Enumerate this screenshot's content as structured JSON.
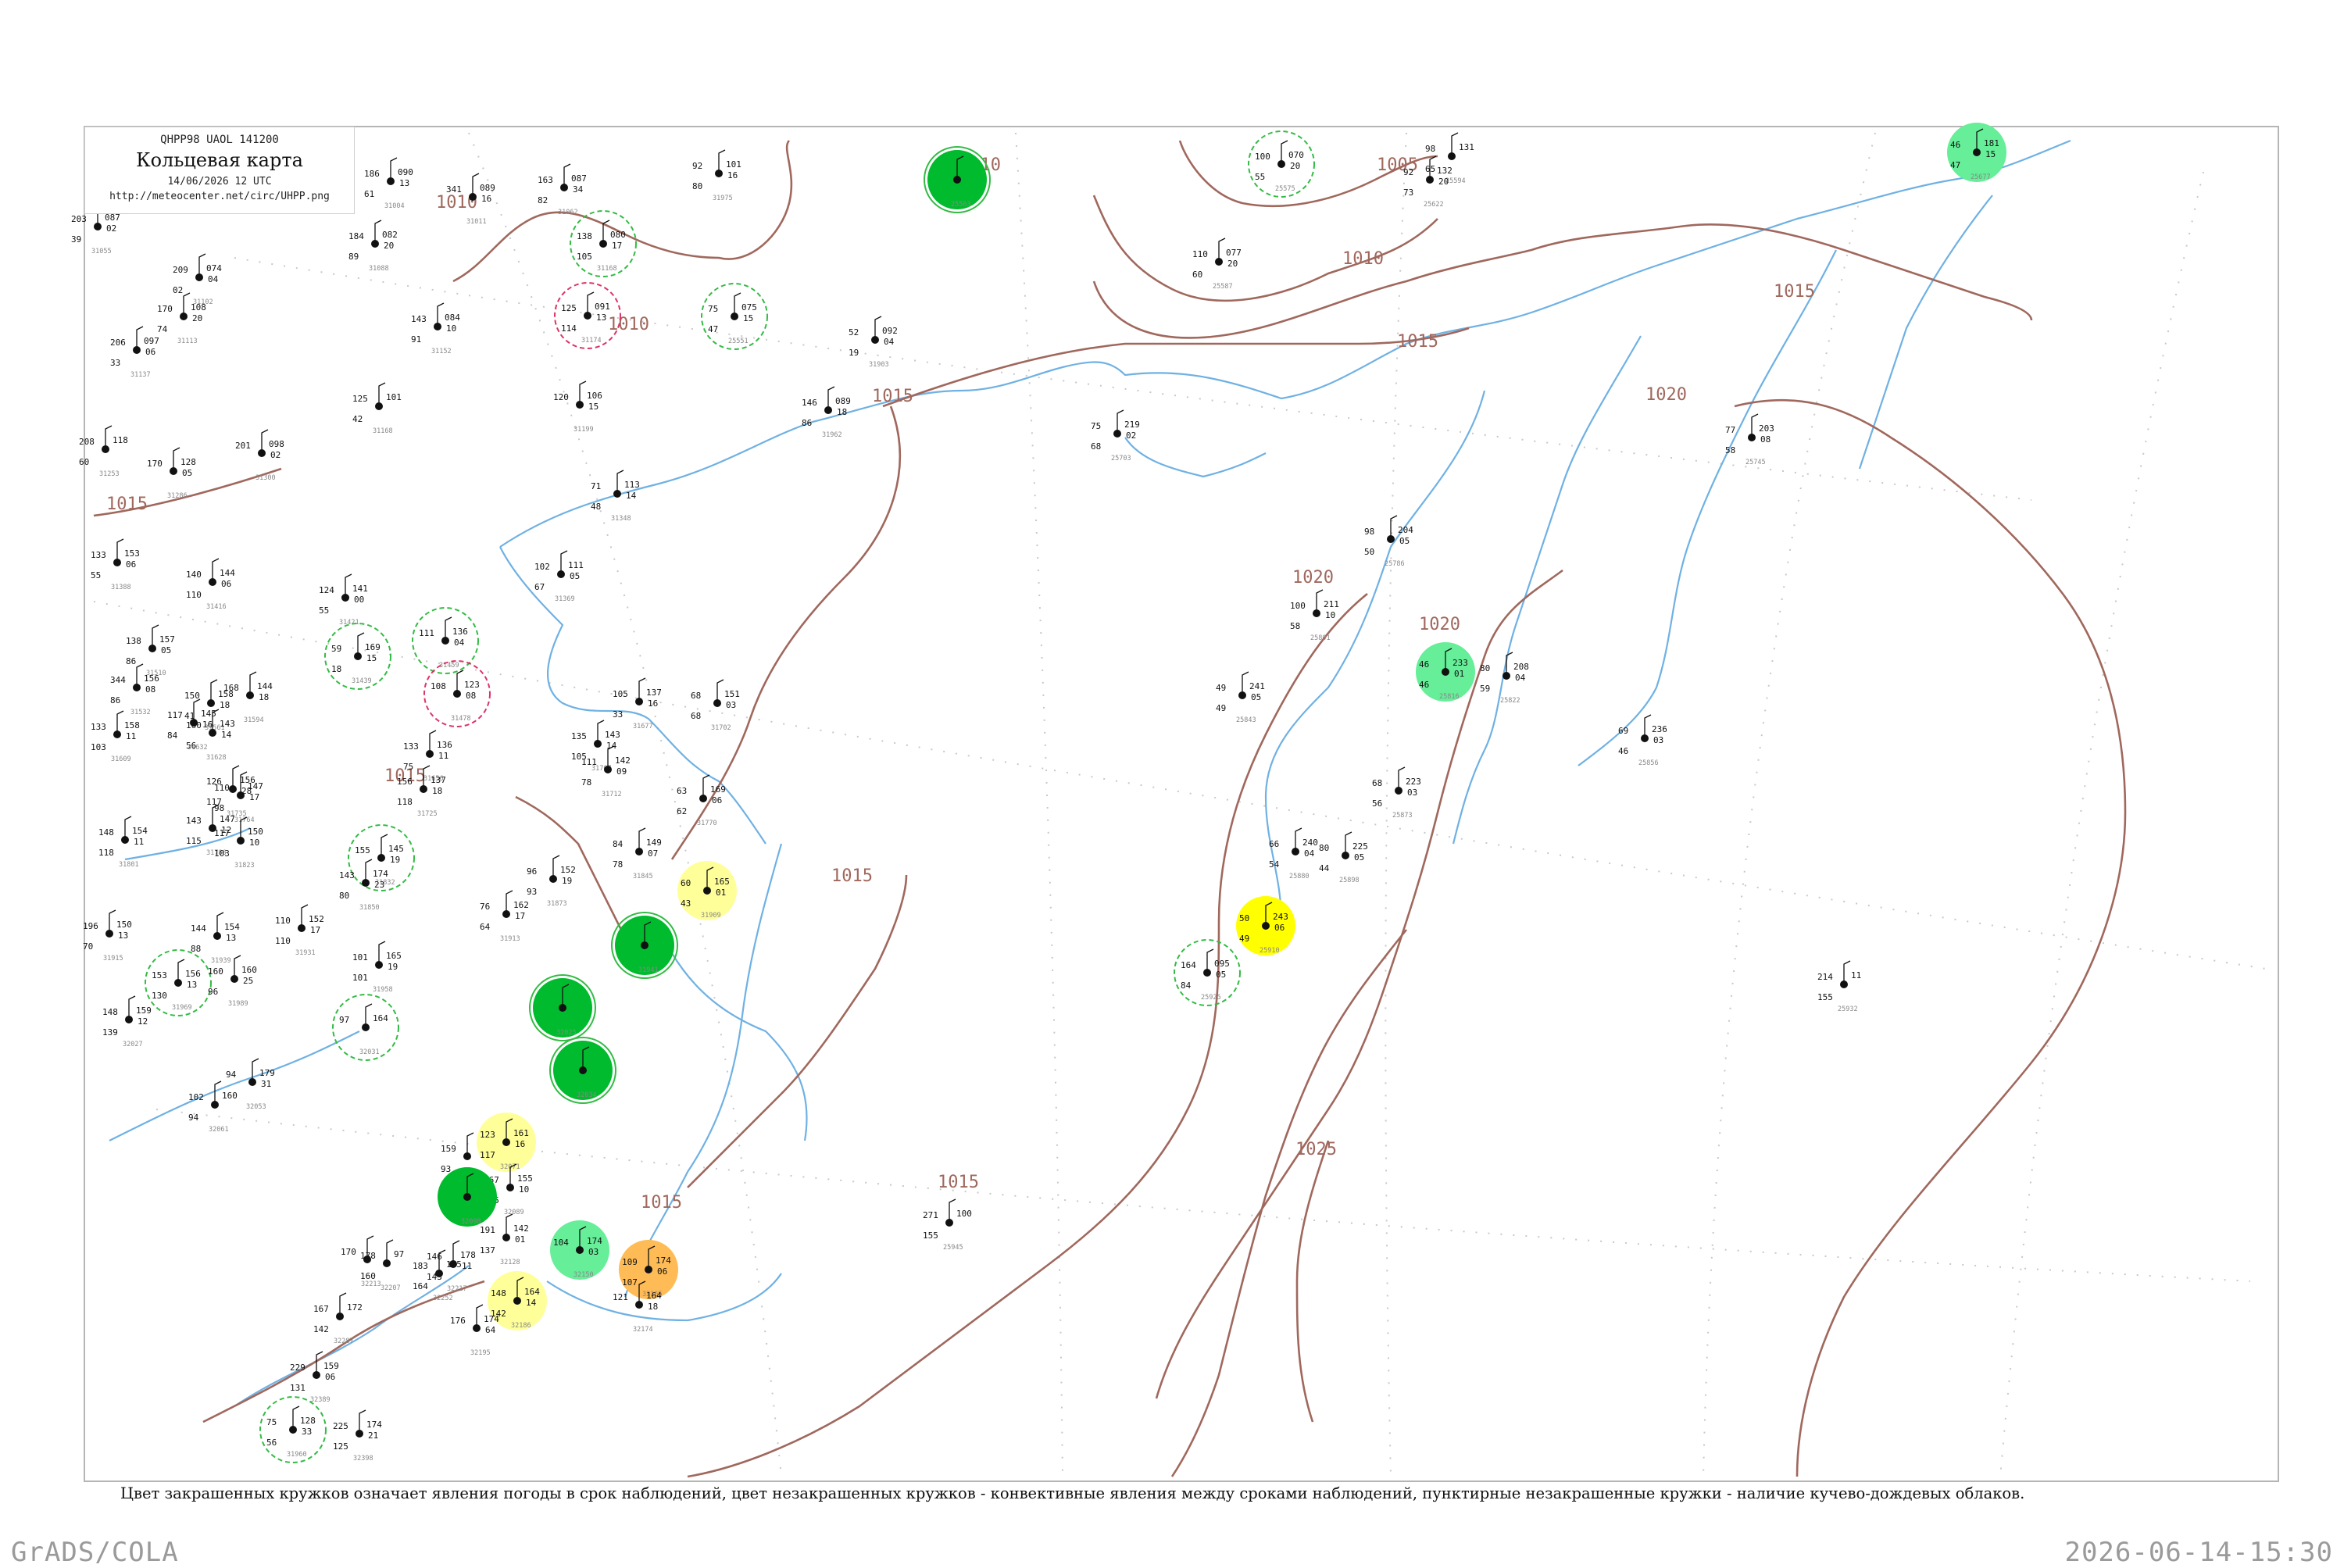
{
  "header": {
    "code": "QHPP98  UAOL  141200",
    "title": "Кольцевая карта",
    "datetime": "14/06/2026 12 UTC",
    "url": "http://meteocenter.net/circ/UHPP.png"
  },
  "footer": {
    "legend": "Цвет закрашенных кружков означает явления погоды в срок наблюдений, цвет незакрашенных кружков - конвективные явления между сроками наблюдений, пунктирные незакрашенные кружки - наличие кучево-дождевых облаков.",
    "credit": "GrADS/COLA",
    "timestamp": "2026-06-14-15:30"
  },
  "colors": {
    "isobar": "#a0685d",
    "coast": "#6fb1e3",
    "green_dark": "#00bb2d",
    "green_light": "#66ee99",
    "yellow": "#ffff00",
    "yellow_light": "#ffff99",
    "orange": "#ffbb55",
    "ring_green": "#33bb44",
    "ring_red": "#dd3366"
  },
  "isobar_labels": [
    "1010",
    "1010",
    "1005",
    "1010",
    "1015",
    "1010",
    "1015",
    "1015",
    "1015",
    "1020",
    "1020",
    "1020",
    "1015",
    "1015",
    "1015",
    "1025",
    "1015"
  ],
  "stations": [
    {
      "idx": "31004",
      "t": "186",
      "p": "090",
      "v": "13",
      "n": "61",
      "fill": "",
      "ring": ""
    },
    {
      "idx": "31055",
      "t": "203",
      "p": "087",
      "v": "02",
      "n": "39",
      "fill": "",
      "ring": ""
    },
    {
      "idx": "31011",
      "t": "341",
      "p": "089",
      "v": "16",
      "n": "",
      "fill": "",
      "ring": ""
    },
    {
      "idx": "31062",
      "t": "163",
      "p": "087",
      "v": "34",
      "n": "82",
      "fill": "",
      "ring": ""
    },
    {
      "idx": "31168",
      "t": "138",
      "p": "080",
      "v": "17",
      "n": "105",
      "fill": "",
      "ring": "green"
    },
    {
      "idx": "31174",
      "t": "125",
      "p": "091",
      "v": "13",
      "n": "114",
      "fill": "",
      "ring": "red"
    },
    {
      "idx": "31088",
      "t": "184",
      "p": "082",
      "v": "20",
      "n": "89",
      "fill": "",
      "ring": ""
    },
    {
      "idx": "31102",
      "t": "209",
      "p": "074",
      "v": "04",
      "n": "02",
      "fill": "",
      "ring": ""
    },
    {
      "idx": "31113",
      "t": "170",
      "p": "108",
      "v": "20",
      "n": "74",
      "fill": "",
      "ring": ""
    },
    {
      "idx": "31137",
      "t": "206",
      "p": "097",
      "v": "06",
      "n": "33",
      "fill": "",
      "ring": ""
    },
    {
      "idx": "31152",
      "t": "143",
      "p": "084",
      "v": "10",
      "n": "91",
      "fill": "",
      "ring": ""
    },
    {
      "idx": "31168b",
      "t": "125",
      "p": "101",
      "v": "",
      "n": "42",
      "fill": "",
      "ring": ""
    },
    {
      "idx": "31199",
      "t": "120",
      "p": "106",
      "v": "15",
      "n": "",
      "fill": "",
      "ring": ""
    },
    {
      "idx": "31253",
      "t": "208",
      "p": "118",
      "v": "",
      "n": "60",
      "fill": "",
      "ring": ""
    },
    {
      "idx": "31286",
      "t": "170",
      "p": "128",
      "v": "05",
      "n": "",
      "fill": "",
      "ring": ""
    },
    {
      "idx": "31300",
      "t": "201",
      "p": "098",
      "v": "02",
      "n": "",
      "fill": "",
      "ring": ""
    },
    {
      "idx": "31348",
      "t": "71",
      "p": "113",
      "v": "14",
      "n": "48",
      "fill": "",
      "ring": ""
    },
    {
      "idx": "31369",
      "t": "102",
      "p": "111",
      "v": "05",
      "n": "67",
      "fill": "",
      "ring": ""
    },
    {
      "idx": "31388",
      "t": "133",
      "p": "153",
      "v": "06",
      "n": "55",
      "fill": "",
      "ring": ""
    },
    {
      "idx": "31416",
      "t": "140",
      "p": "144",
      "v": "06",
      "n": "110",
      "fill": "",
      "ring": ""
    },
    {
      "idx": "31421",
      "t": "124",
      "p": "141",
      "v": "00",
      "n": "55",
      "fill": "",
      "ring": ""
    },
    {
      "idx": "31439",
      "t": "59",
      "p": "169",
      "v": "15",
      "n": "18",
      "fill": "",
      "ring": "green"
    },
    {
      "idx": "31459",
      "t": "111",
      "p": "136",
      "v": "04",
      "n": "",
      "fill": "",
      "ring": "green"
    },
    {
      "idx": "31478",
      "t": "108",
      "p": "123",
      "v": "08",
      "n": "",
      "fill": "",
      "ring": "red"
    },
    {
      "idx": "31510",
      "t": "138",
      "p": "157",
      "v": "05",
      "n": "86",
      "fill": "",
      "ring": ""
    },
    {
      "idx": "31532",
      "t": "344",
      "p": "156",
      "v": "08",
      "n": "86",
      "fill": "",
      "ring": ""
    },
    {
      "idx": "31561",
      "t": "150",
      "p": "158",
      "v": "18",
      "n": "41",
      "fill": "",
      "ring": ""
    },
    {
      "idx": "31594",
      "t": "168",
      "p": "144",
      "v": "18",
      "n": "",
      "fill": "",
      "ring": ""
    },
    {
      "idx": "31609",
      "t": "133",
      "p": "158",
      "v": "11",
      "n": "103",
      "fill": "",
      "ring": ""
    },
    {
      "idx": "31628",
      "t": "160",
      "p": "143",
      "v": "14",
      "n": "56",
      "fill": "",
      "ring": ""
    },
    {
      "idx": "31632",
      "t": "117",
      "p": "145",
      "v": "16",
      "n": "84",
      "fill": "",
      "ring": ""
    },
    {
      "idx": "31656",
      "t": "133",
      "p": "136",
      "v": "11",
      "n": "75",
      "fill": "",
      "ring": ""
    },
    {
      "idx": "31677",
      "t": "105",
      "p": "137",
      "v": "16",
      "n": "33",
      "fill": "",
      "ring": ""
    },
    {
      "idx": "31702",
      "t": "68",
      "p": "151",
      "v": "03",
      "n": "68",
      "fill": "",
      "ring": ""
    },
    {
      "idx": "31707",
      "t": "135",
      "p": "143",
      "v": "14",
      "n": "105",
      "fill": "",
      "ring": ""
    },
    {
      "idx": "31712",
      "t": "111",
      "p": "142",
      "v": "09",
      "n": "78",
      "fill": "",
      "ring": ""
    },
    {
      "idx": "31725",
      "t": "156",
      "p": "137",
      "v": "18",
      "n": "118",
      "fill": "",
      "ring": ""
    },
    {
      "idx": "31735",
      "t": "126",
      "p": "156",
      "v": "28",
      "n": "117",
      "fill": "",
      "ring": ""
    },
    {
      "idx": "31764",
      "t": "110",
      "p": "147",
      "v": "17",
      "n": "98",
      "fill": "",
      "ring": ""
    },
    {
      "idx": "31770",
      "t": "63",
      "p": "169",
      "v": "06",
      "n": "62",
      "fill": "",
      "ring": ""
    },
    {
      "idx": "31786",
      "t": "143",
      "p": "147",
      "v": "12",
      "n": "115",
      "fill": "",
      "ring": ""
    },
    {
      "idx": "31801",
      "t": "148",
      "p": "154",
      "v": "11",
      "n": "118",
      "fill": "",
      "ring": ""
    },
    {
      "idx": "31823",
      "t": "117",
      "p": "150",
      "v": "10",
      "n": "103",
      "fill": "",
      "ring": ""
    },
    {
      "idx": "31832",
      "t": "155",
      "p": "145",
      "v": "19",
      "n": "",
      "fill": "",
      "ring": "green"
    },
    {
      "idx": "31845",
      "t": "84",
      "p": "149",
      "v": "07",
      "n": "78",
      "fill": "",
      "ring": ""
    },
    {
      "idx": "31850",
      "t": "143",
      "p": "174",
      "v": "23",
      "n": "80",
      "fill": "",
      "ring": ""
    },
    {
      "idx": "31873",
      "t": "96",
      "p": "152",
      "v": "19",
      "n": "93",
      "fill": "",
      "ring": ""
    },
    {
      "idx": "31909",
      "t": "60",
      "p": "165",
      "v": "01",
      "n": "43",
      "fill": "yellow_light",
      "ring": ""
    },
    {
      "idx": "31913",
      "t": "76",
      "p": "162",
      "v": "17",
      "n": "64",
      "fill": "",
      "ring": ""
    },
    {
      "idx": "31915",
      "t": "196",
      "p": "150",
      "v": "13",
      "n": "70",
      "fill": "",
      "ring": ""
    },
    {
      "idx": "31931",
      "t": "110",
      "p": "152",
      "v": "17",
      "n": "110",
      "fill": "",
      "ring": ""
    },
    {
      "idx": "31939",
      "t": "144",
      "p": "154",
      "v": "13",
      "n": "88",
      "fill": "",
      "ring": ""
    },
    {
      "idx": "31941",
      "t": "",
      "p": "",
      "v": "",
      "n": "",
      "fill": "green_dark",
      "ring": "green"
    },
    {
      "idx": "31958",
      "t": "101",
      "p": "165",
      "v": "19",
      "n": "101",
      "fill": "",
      "ring": ""
    },
    {
      "idx": "31969",
      "t": "153",
      "p": "156",
      "v": "13",
      "n": "130",
      "fill": "",
      "ring": "green"
    },
    {
      "idx": "31989",
      "t": "160",
      "p": "160",
      "v": "25",
      "n": "96",
      "fill": "",
      "ring": ""
    },
    {
      "idx": "32025",
      "t": "",
      "p": "",
      "v": "",
      "n": "",
      "fill": "green_dark",
      "ring": "green"
    },
    {
      "idx": "32027",
      "t": "148",
      "p": "159",
      "v": "12",
      "n": "139",
      "fill": "",
      "ring": ""
    },
    {
      "idx": "32031",
      "t": "97",
      "p": "164",
      "v": "",
      "n": "",
      "fill": "",
      "ring": "green"
    },
    {
      "idx": "32034",
      "t": "",
      "p": "",
      "v": "",
      "n": "",
      "fill": "green_dark",
      "ring": "green"
    },
    {
      "idx": "32053",
      "t": "94",
      "p": "179",
      "v": "31",
      "n": "",
      "fill": "",
      "ring": ""
    },
    {
      "idx": "32061",
      "t": "102",
      "p": "160",
      "v": "",
      "n": "94",
      "fill": "",
      "ring": ""
    },
    {
      "idx": "32071",
      "t": "123",
      "p": "161",
      "v": "16",
      "n": "117",
      "fill": "yellow_light",
      "ring": ""
    },
    {
      "idx": "32076",
      "t": "159",
      "p": "",
      "v": "",
      "n": "93",
      "fill": "",
      "ring": ""
    },
    {
      "idx": "32089",
      "t": "167",
      "p": "155",
      "v": "10",
      "n": "155",
      "fill": "",
      "ring": ""
    },
    {
      "idx": "32098",
      "t": "",
      "p": "",
      "v": "",
      "n": "",
      "fill": "green_dark",
      "ring": ""
    },
    {
      "idx": "32128",
      "t": "191",
      "p": "142",
      "v": "01",
      "n": "137",
      "fill": "",
      "ring": ""
    },
    {
      "idx": "32150",
      "t": "104",
      "p": "174",
      "v": "03",
      "n": "",
      "fill": "green_light",
      "ring": ""
    },
    {
      "idx": "32165",
      "t": "109",
      "p": "174",
      "v": "06",
      "n": "107",
      "fill": "orange",
      "ring": ""
    },
    {
      "idx": "32174",
      "t": "121",
      "p": "164",
      "v": "18",
      "n": "",
      "fill": "",
      "ring": ""
    },
    {
      "idx": "32186",
      "t": "148",
      "p": "164",
      "v": "14",
      "n": "142",
      "fill": "yellow_light",
      "ring": ""
    },
    {
      "idx": "32195",
      "t": "176",
      "p": "174",
      "v": "64",
      "n": "",
      "fill": "",
      "ring": ""
    },
    {
      "idx": "32207",
      "t": "178",
      "p": "97",
      "v": "",
      "n": "160",
      "fill": "",
      "ring": ""
    },
    {
      "idx": "32213",
      "t": "170",
      "p": "",
      "v": "",
      "n": "",
      "fill": "",
      "ring": ""
    },
    {
      "idx": "32217",
      "t": "146",
      "p": "178",
      "v": "11",
      "n": "143",
      "fill": "",
      "ring": ""
    },
    {
      "idx": "32252",
      "t": "183",
      "p": "175",
      "v": "",
      "n": "164",
      "fill": "",
      "ring": ""
    },
    {
      "idx": "32287",
      "t": "167",
      "p": "172",
      "v": "",
      "n": "142",
      "fill": "",
      "ring": ""
    },
    {
      "idx": "32389",
      "t": "229",
      "p": "159",
      "v": "06",
      "n": "131",
      "fill": "",
      "ring": ""
    },
    {
      "idx": "32398",
      "t": "225",
      "p": "174",
      "v": "21",
      "n": "125",
      "fill": "",
      "ring": ""
    },
    {
      "idx": "31960",
      "t": "75",
      "p": "128",
      "v": "33",
      "n": "56",
      "fill": "",
      "ring": "green"
    },
    {
      "idx": "31903",
      "t": "52",
      "p": "092",
      "v": "04",
      "n": "19",
      "fill": "",
      "ring": ""
    },
    {
      "idx": "31962",
      "t": "146",
      "p": "089",
      "v": "18",
      "n": "86",
      "fill": "",
      "ring": ""
    },
    {
      "idx": "31975",
      "t": "92",
      "p": "101",
      "v": "16",
      "n": "80",
      "fill": "",
      "ring": ""
    },
    {
      "idx": "25551",
      "t": "75",
      "p": "075",
      "v": "15",
      "n": "47",
      "fill": "",
      "ring": "green"
    },
    {
      "idx": "25563",
      "t": "",
      "p": "",
      "v": "",
      "n": "",
      "fill": "green_dark",
      "ring": "green"
    },
    {
      "idx": "25575",
      "t": "100",
      "p": "070",
      "v": "20",
      "n": "55",
      "fill": "",
      "ring": "green"
    },
    {
      "idx": "25587",
      "t": "110",
      "p": "077",
      "v": "20",
      "n": "60",
      "fill": "",
      "ring": ""
    },
    {
      "idx": "25594",
      "t": "98",
      "p": "131",
      "v": "",
      "n": "65",
      "fill": "",
      "ring": ""
    },
    {
      "idx": "25622",
      "t": "92",
      "p": "132",
      "v": "20",
      "n": "73",
      "fill": "",
      "ring": ""
    },
    {
      "idx": "25677",
      "t": "46",
      "p": "181",
      "v": "15",
      "n": "47",
      "fill": "green_light",
      "ring": ""
    },
    {
      "idx": "25703",
      "t": "75",
      "p": "219",
      "v": "02",
      "n": "68",
      "fill": "",
      "ring": ""
    },
    {
      "idx": "25745",
      "t": "77",
      "p": "203",
      "v": "08",
      "n": "58",
      "fill": "",
      "ring": ""
    },
    {
      "idx": "25786",
      "t": "98",
      "p": "204",
      "v": "05",
      "n": "50",
      "fill": "",
      "ring": ""
    },
    {
      "idx": "25801",
      "t": "100",
      "p": "211",
      "v": "10",
      "n": "58",
      "fill": "",
      "ring": ""
    },
    {
      "idx": "25816",
      "t": "46",
      "p": "233",
      "v": "01",
      "n": "46",
      "fill": "green_light",
      "ring": ""
    },
    {
      "idx": "25822",
      "t": "80",
      "p": "208",
      "v": "04",
      "n": "59",
      "fill": "",
      "ring": ""
    },
    {
      "idx": "25843",
      "t": "49",
      "p": "241",
      "v": "05",
      "n": "49",
      "fill": "",
      "ring": ""
    },
    {
      "idx": "25856",
      "t": "69",
      "p": "236",
      "v": "03",
      "n": "46",
      "fill": "",
      "ring": ""
    },
    {
      "idx": "25873",
      "t": "68",
      "p": "223",
      "v": "03",
      "n": "56",
      "fill": "",
      "ring": ""
    },
    {
      "idx": "25880",
      "t": "66",
      "p": "240",
      "v": "04",
      "n": "54",
      "fill": "",
      "ring": ""
    },
    {
      "idx": "25898",
      "t": "80",
      "p": "225",
      "v": "05",
      "n": "44",
      "fill": "",
      "ring": ""
    },
    {
      "idx": "25910",
      "t": "50",
      "p": "243",
      "v": "06",
      "n": "49",
      "fill": "yellow",
      "ring": ""
    },
    {
      "idx": "25925",
      "t": "164",
      "p": "095",
      "v": "05",
      "n": "84",
      "fill": "",
      "ring": "green"
    },
    {
      "idx": "25932",
      "t": "214",
      "p": "11",
      "v": "",
      "n": "155",
      "fill": "",
      "ring": ""
    },
    {
      "idx": "25945",
      "t": "271",
      "p": "100",
      "v": "",
      "n": "155",
      "fill": "",
      "ring": ""
    }
  ]
}
